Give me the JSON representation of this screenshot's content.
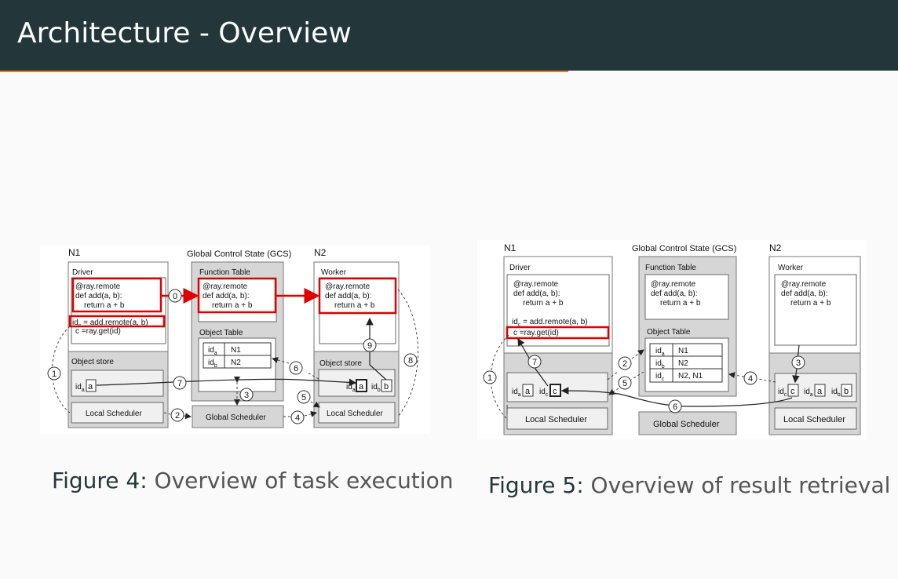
{
  "slide": {
    "title": "Architecture - Overview"
  },
  "colors": {
    "header_bg": "#23373b",
    "accent": "#eb811b",
    "highlight": "#e00000",
    "node_gray": "#d6d6d6"
  },
  "figure4": {
    "caption_label": "Figure 4:",
    "caption_text": "Overview of task execution",
    "n1_label": "N1",
    "gcs_label": "Global Control State (GCS)",
    "n2_label": "N2",
    "driver_label": "Driver",
    "code_line1": "@ray.remote",
    "code_line2": "def add(a, b):",
    "code_line3": "return a + b",
    "call_pre": "id",
    "call_sub": "c",
    "call_post": " = add.remote(a, b)",
    "get_line": "c =ray.get(id)",
    "function_table": "Function Table",
    "object_table": "Object Table",
    "ot_rows": [
      {
        "sub": "a",
        "loc": "N1"
      },
      {
        "sub": "b",
        "loc": "N2"
      }
    ],
    "worker_label": "Worker",
    "object_store_label": "Object store",
    "local_scheduler": "Local Scheduler",
    "global_scheduler": "Global Scheduler",
    "id_text": "id",
    "sub_a": "a",
    "sub_b": "b",
    "val_a": "a",
    "val_b": "b",
    "steps": [
      "0",
      "1",
      "2",
      "3",
      "4",
      "5",
      "6",
      "7",
      "8",
      "9"
    ]
  },
  "figure5": {
    "caption_label": "Figure 5:",
    "caption_text": "Overview of result retrieval",
    "n1_label": "N1",
    "gcs_label": "Global Control State (GCS)",
    "n2_label": "N2",
    "driver_label": "Driver",
    "code_line1": "@ray.remote",
    "code_line2": "def add(a, b):",
    "code_line3": "return a + b",
    "call_pre": "id",
    "call_sub": "c",
    "call_post": " = add.remote(a, b)",
    "get_line": "c =ray.get(id)",
    "function_table": "Function Table",
    "object_table": "Object Table",
    "ot_rows": [
      {
        "sub": "a",
        "loc": "N1"
      },
      {
        "sub": "b",
        "loc": "N2"
      },
      {
        "sub": "c",
        "loc": "N2, N1"
      }
    ],
    "worker_label": "Worker",
    "local_scheduler": "Local Scheduler",
    "global_scheduler": "Global Scheduler",
    "id_text": "id",
    "sub_a": "a",
    "sub_b": "b",
    "sub_c": "c",
    "val_a": "a",
    "val_b": "b",
    "val_c": "c",
    "steps": [
      "1",
      "2",
      "3",
      "4",
      "5",
      "6",
      "7"
    ]
  }
}
